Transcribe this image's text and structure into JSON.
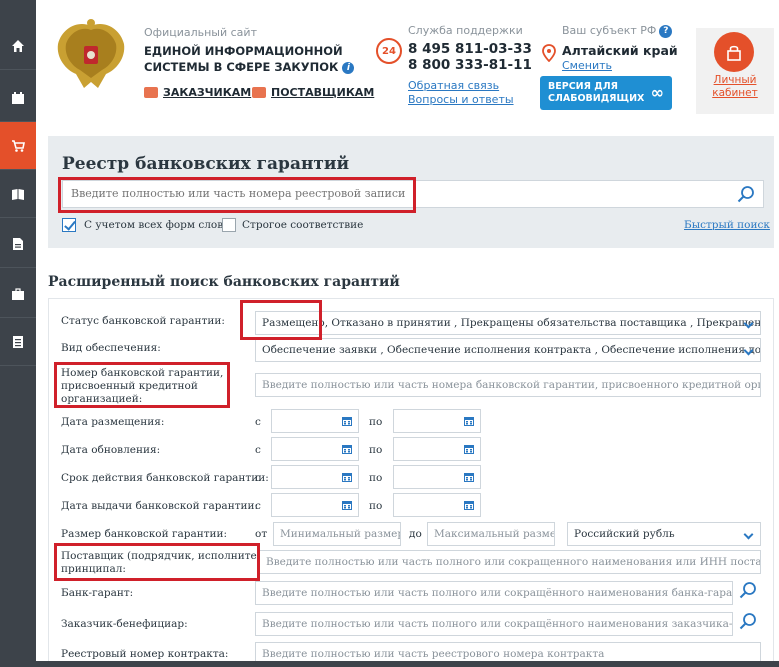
{
  "sidebar": {
    "icons": [
      "home-icon",
      "calendar-icon",
      "cart-icon",
      "book-icon",
      "document-icon",
      "briefcase-icon",
      "list-icon"
    ],
    "active_index": 2
  },
  "header": {
    "site_sub": "Официальный сайт",
    "site_title_1": "ЕДИНОЙ ИНФОРМАЦИОННОЙ",
    "site_title_2": "СИСТЕМЫ В СФЕРЕ ЗАКУПОК",
    "link_customers": "ЗАКАЗЧИКАМ",
    "link_suppliers": "ПОСТАВЩИКАМ",
    "support_label": "Служба поддержки",
    "clock_text": "24",
    "phone_1": "8 495 811-03-33",
    "phone_2": "8 800 333-81-11",
    "feedback_link": "Обратная связь",
    "faq_link": "Вопросы и ответы",
    "region_label": "Ваш субъект РФ",
    "region_value": "Алтайский край",
    "region_change": "Сменить",
    "accessible_1": "ВЕРСИЯ ДЛЯ",
    "accessible_2": "СЛАБОВИДЯЩИХ",
    "cabinet_1": "Личный",
    "cabinet_2": "кабинет",
    "accent_color": "#e4502a",
    "link_color": "#2a78c2"
  },
  "registry": {
    "title": "Реестр банковских гарантий",
    "search_placeholder": "Введите полностью или часть номера реестровой записи",
    "check_all_forms": "С учетом всех форм слов",
    "check_all_forms_checked": true,
    "check_strict": "Строгое соответствие",
    "check_strict_checked": false,
    "quick_search": "Быстрый поиск"
  },
  "advanced": {
    "title": "Расширенный поиск банковских гарантий",
    "status_label": "Статус банковской гарантии:",
    "status_value_first": "Размещено",
    "status_value_rest": ", Отказано в принятии , Прекращены обязательства поставщика , Прекращены",
    "security_label": "Вид обеспечения:",
    "security_value": "Обеспечение заявки , Обеспечение исполнения контракта , Обеспечение исполнения договора о",
    "number_label_1": "Номер банковской гарантии,",
    "number_label_2": "присвоенный кредитной",
    "number_label_3": "организацией:",
    "number_placeholder": "Введите полностью или часть номера  банковской гарантии, присвоенного кредитной организацией",
    "date_rows": [
      {
        "label": "Дата размещения:"
      },
      {
        "label": "Дата обновления:"
      },
      {
        "label": "Срок действия банковской гарантии:"
      },
      {
        "label": "Дата выдачи банковской гарантии:"
      }
    ],
    "from": "с",
    "to": "по",
    "amount_label": "Размер банковской гарантии:",
    "amount_from": "от",
    "amount_to": "до",
    "amount_min_placeholder": "Минимальный размер",
    "amount_max_placeholder": "Максимальный размер",
    "currency": "Российский рубль",
    "supplier_label_1": "Поставщик (подрядчик, исполнитель)-",
    "supplier_label_2": "принципал:",
    "supplier_placeholder": "Введите полностью или часть полного или сокращенного наименования или ИНН поставщика (подр",
    "bank_label": "Банк-гарант:",
    "bank_placeholder": "Введите полностью или часть полного или сокращённого наименования банка-гаранта, ИНН",
    "customer_label": "Заказчик-бенефициар:",
    "customer_placeholder": "Введите полностью или часть полного или сокращённого наименования заказчика-бенефици",
    "contract_label": "Реестровый номер контракта:",
    "contract_placeholder": "Введите полностью или часть реестрового номера контракта"
  }
}
